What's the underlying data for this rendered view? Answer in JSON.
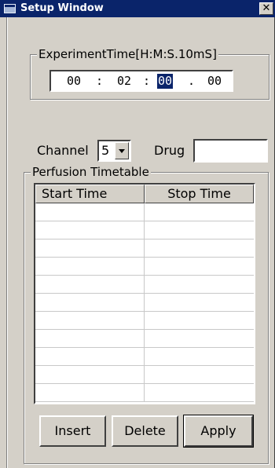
{
  "window": {
    "title": "Setup Window",
    "close_glyph": "✕",
    "icon": "window-icon"
  },
  "experiment_time": {
    "legend": "ExperimentTime[H:M:S.10mS]",
    "hours": "00",
    "sep1": ":",
    "minutes": "02",
    "sep2": ":",
    "seconds": "00",
    "sep3": ".",
    "tens_ms": "00"
  },
  "channel": {
    "label": "Channel",
    "value": "5"
  },
  "drug": {
    "label": "Drug",
    "value": ""
  },
  "perfusion": {
    "legend": "Perfusion Timetable",
    "columns": [
      "Start Time",
      "Stop Time"
    ],
    "rows": [
      [
        "",
        ""
      ],
      [
        "",
        ""
      ],
      [
        "",
        ""
      ],
      [
        "",
        ""
      ],
      [
        "",
        ""
      ],
      [
        "",
        ""
      ],
      [
        "",
        ""
      ],
      [
        "",
        ""
      ],
      [
        "",
        ""
      ],
      [
        "",
        ""
      ],
      [
        "",
        ""
      ]
    ]
  },
  "buttons": {
    "insert": "Insert",
    "delete": "Delete",
    "apply": "Apply"
  }
}
